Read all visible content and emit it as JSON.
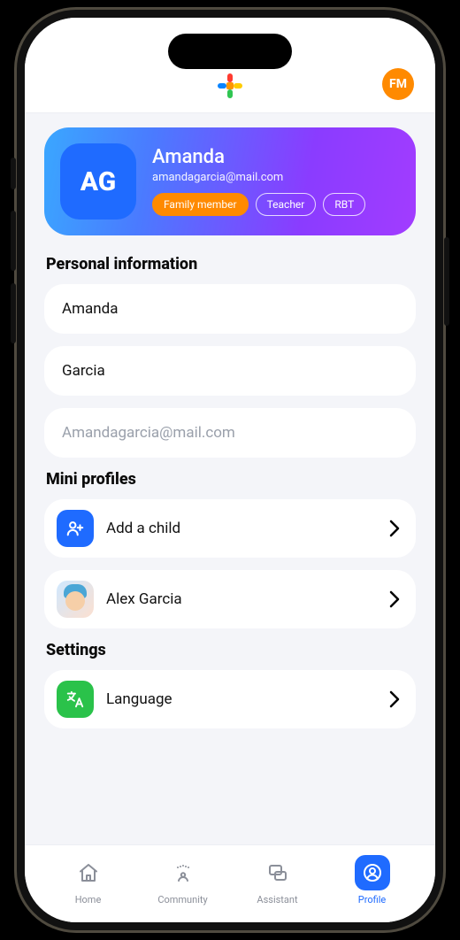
{
  "topbar": {
    "user_initials": "FM"
  },
  "hero": {
    "initials": "AG",
    "name": "Amanda",
    "email": "amandagarcia@mail.com",
    "roles": [
      {
        "label": "Family member",
        "selected": true
      },
      {
        "label": "Teacher",
        "selected": false
      },
      {
        "label": "RBT",
        "selected": false
      }
    ]
  },
  "sections": {
    "personal_title": "Personal information",
    "first_name": "Amanda",
    "last_name": "Garcia",
    "email_value": "Amandagarcia@mail.com",
    "mini_title": "Mini profiles",
    "add_child_label": "Add a child",
    "child_name": "Alex Garcia",
    "settings_title": "Settings",
    "language_label": "Language"
  },
  "tabs": {
    "home": "Home",
    "community": "Community",
    "assistant": "Assistant",
    "profile": "Profile"
  }
}
